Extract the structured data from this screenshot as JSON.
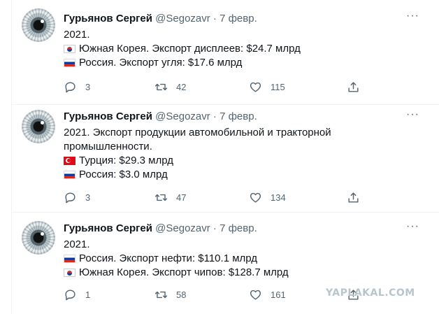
{
  "tweets": [
    {
      "author_name": "Гурьянов Сергей",
      "meta": "@Segozavr · 7 февр.",
      "avatar_icon": "eye-avatar",
      "lines": [
        {
          "flag": "",
          "text": "2021."
        },
        {
          "flag": "south-korea-flag",
          "text": "Южная Корея. Экспорт дисплеев: $24.7 млрд"
        },
        {
          "flag": "russia-flag",
          "text": "Россия. Экспорт угля: $17.6 млрд"
        }
      ],
      "replies": "3",
      "retweets": "42",
      "likes": "115"
    },
    {
      "author_name": "Гурьянов Сергей",
      "meta": "@Segozavr · 7 февр.",
      "avatar_icon": "eye-avatar",
      "lines": [
        {
          "flag": "",
          "text": "2021. Экспорт продукции автомобильной и тракторной"
        },
        {
          "flag": "",
          "text": "промышленности."
        },
        {
          "flag": "turkey-flag",
          "text": "Турция: $29.3 млрд"
        },
        {
          "flag": "russia-flag",
          "text": "Россия: $3.0 млрд"
        }
      ],
      "replies": "3",
      "retweets": "47",
      "likes": "134"
    },
    {
      "author_name": "Гурьянов Сергей",
      "meta": "@Segozavr · 7 февр.",
      "avatar_icon": "eye-avatar",
      "lines": [
        {
          "flag": "",
          "text": "2021."
        },
        {
          "flag": "russia-flag",
          "text": "Россия. Экспорт нефти: $110.1 млрд"
        },
        {
          "flag": "south-korea-flag",
          "text": "Южная Корея. Экспорт чипов: $128.7 млрд"
        }
      ],
      "replies": "1",
      "retweets": "58",
      "likes": "161"
    }
  ],
  "more_glyph": "···",
  "watermark": "YAPLAKAL.COM",
  "colors": {
    "text": "#0f1419",
    "secondary": "#536471",
    "divider": "#eff3f4",
    "watermark": "#b8c6cc"
  }
}
